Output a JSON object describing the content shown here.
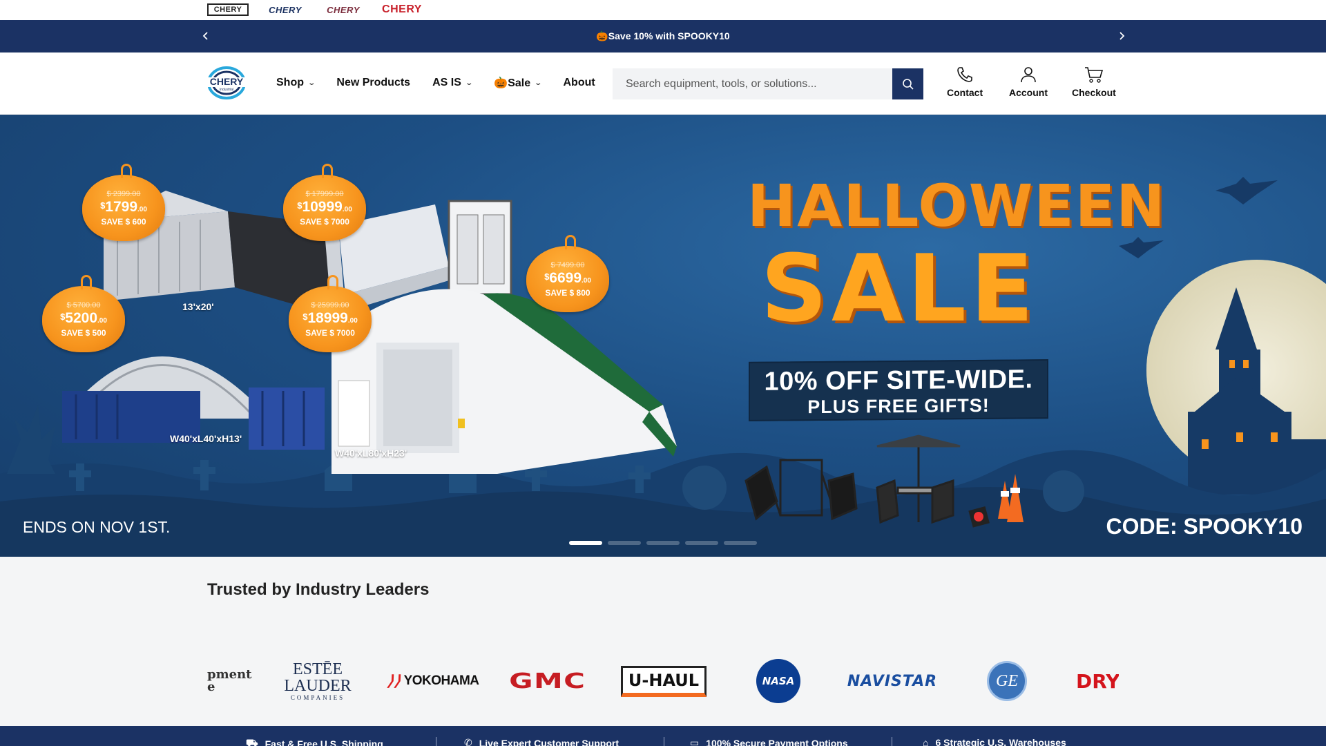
{
  "brand_strip": {
    "logos": [
      {
        "text": "CHERY"
      },
      {
        "text": "CHERY"
      },
      {
        "text": "CHERY"
      },
      {
        "text": "CHERY"
      }
    ]
  },
  "announcement": {
    "icon": "🎃",
    "message": "Save 10% with SPOOKY10",
    "prev_label": "‹",
    "next_label": "›"
  },
  "header": {
    "logo_text": "CHERY",
    "logo_sub": "Industrial",
    "nav": [
      {
        "label": "Shop",
        "has_dropdown": true
      },
      {
        "label": "New Products",
        "has_dropdown": false
      },
      {
        "label": "AS IS",
        "has_dropdown": true
      },
      {
        "label": "🎃Sale",
        "has_dropdown": true
      },
      {
        "label": "About",
        "has_dropdown": false
      }
    ],
    "search": {
      "placeholder": "Search equipment, tools, or solutions..."
    },
    "actions": {
      "contact": "Contact",
      "account": "Account",
      "checkout": "Checkout"
    }
  },
  "hero": {
    "title_line1": "HALLOWEEN",
    "title_line2": "SALE",
    "promo_line1": "10% OFF SITE-WIDE.",
    "promo_line2": "PLUS FREE GIFTS!",
    "ends": "ENDS ON NOV 1ST.",
    "code": "CODE: SPOOKY10",
    "price_tags": [
      {
        "old": "$ 2399.00",
        "currency": "$",
        "price": "1799",
        "cents": ".00",
        "save": "SAVE $ 600"
      },
      {
        "old": "$ 17999.00",
        "currency": "$",
        "price": "10999",
        "cents": ".00",
        "save": "SAVE $ 7000"
      },
      {
        "old": "$ 7499.00",
        "currency": "$",
        "price": "6699",
        "cents": ".00",
        "save": "SAVE $ 800"
      },
      {
        "old": "$ 5700.00",
        "currency": "$",
        "price": "5200",
        "cents": ".00",
        "save": "SAVE $ 500"
      },
      {
        "old": "$ 25999.00",
        "currency": "$",
        "price": "18999",
        "cents": ".00",
        "save": "SAVE $ 7000"
      }
    ],
    "dimensions": [
      "13'x20'",
      "W40'xL40'xH13'",
      "W40'xL80'xH23'"
    ],
    "slides": 5,
    "active_slide": 1
  },
  "trusted": {
    "title": "Trusted by Industry Leaders",
    "logos": [
      {
        "name": "equipment-partner",
        "text": "pment",
        "text2": "e"
      },
      {
        "name": "estee-lauder",
        "text": "ESTĒE",
        "text2": "LAUDER",
        "text3": "COMPANIES"
      },
      {
        "name": "yokohama",
        "text": "YOKOHAMA"
      },
      {
        "name": "gmc",
        "text": "GMC"
      },
      {
        "name": "uhaul",
        "text": "U-HAUL"
      },
      {
        "name": "nasa",
        "text": "NASA"
      },
      {
        "name": "navistar",
        "text": "NAVISTAR"
      },
      {
        "name": "ge",
        "text": "GE"
      },
      {
        "name": "dry",
        "text": "DRY"
      }
    ]
  },
  "features": [
    {
      "icon": "truck-icon",
      "label": "Fast & Free U.S. Shipping"
    },
    {
      "icon": "phone-icon",
      "label": "Live Expert Customer Support"
    },
    {
      "icon": "card-icon",
      "label": "100% Secure Payment Options"
    },
    {
      "icon": "warehouse-icon",
      "label": "6 Strategic U.S. Warehouses"
    }
  ],
  "colors": {
    "navy": "#1b3264",
    "orange": "#f7941d",
    "hero_blue": "#1d4f84"
  }
}
